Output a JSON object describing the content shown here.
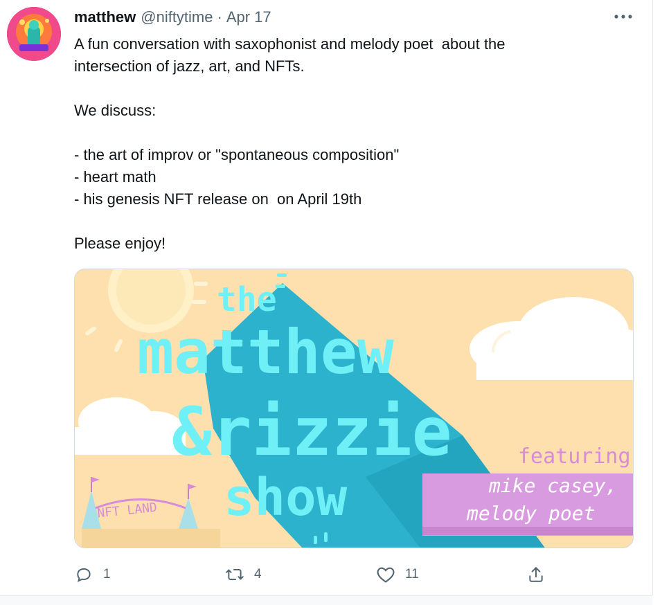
{
  "tweet": {
    "author_name": "matthew",
    "handle": "@niftytime",
    "separator": "·",
    "date": "Apr 17",
    "more_label": "•••",
    "text": "A fun conversation with saxophonist and melody poet  about the\nintersection of jazz, art, and NFTs.\n\nWe discuss:\n\n- the art of improv or \"spontaneous composition\"\n- heart math\n- his genesis NFT release on  on April 19th\n\nPlease enjoy!"
  },
  "media": {
    "title_line1": "the",
    "title_line2": "matthew",
    "title_line3": "&rizzie",
    "title_line4": "show",
    "featuring_label": "featuring",
    "guest_line1": "mike casey,",
    "guest_line2": "melody poet",
    "sign_text": "NFT LAND",
    "colors": {
      "background": "#fde0ae",
      "title": "#6ff0f6",
      "shadow": "#2cb2cc",
      "banner": "#d99bdf",
      "featuring": "#d78bd9"
    }
  },
  "actions": {
    "reply_count": "1",
    "retweet_count": "4",
    "like_count": "11",
    "icons": [
      "reply-icon",
      "retweet-icon",
      "like-icon",
      "share-icon"
    ]
  }
}
